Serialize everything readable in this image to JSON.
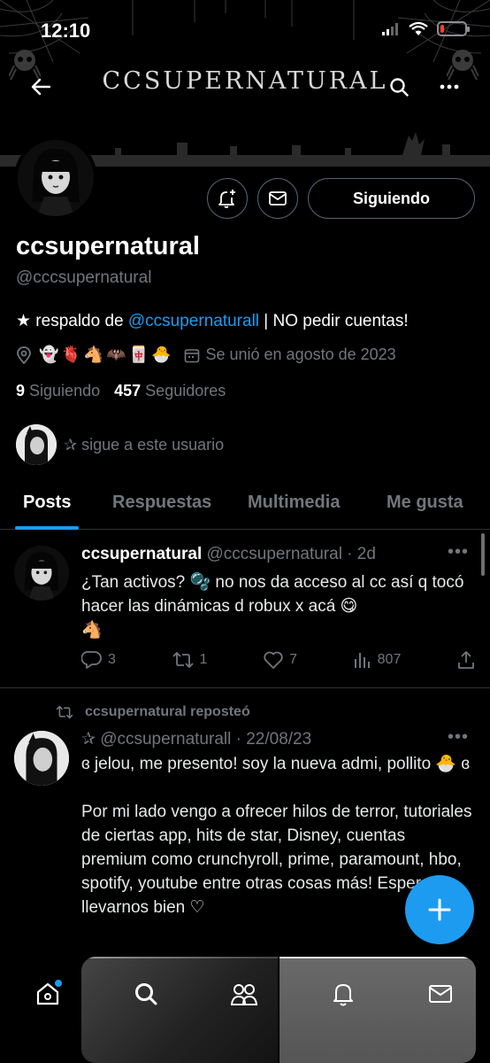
{
  "status_bar": {
    "time": "12:10",
    "battery_level": 0.15
  },
  "header": {
    "banner_title": "CCSUPERNATURAL"
  },
  "profile": {
    "follow_state_label": "Siguiendo",
    "display_name": "ccsupernatural",
    "handle": "@cccsupernatural",
    "bio_prefix": "★ respaldo de ",
    "bio_mention": "@ccsupernaturall",
    "bio_suffix": " | NO pedir cuentas!",
    "location_emojis": "👻🫀🐴🦇🀄🐣",
    "joined": "Se unió en agosto de 2023",
    "following_count": "9",
    "following_label": "Siguiendo",
    "followers_count": "457",
    "followers_label": "Seguidores",
    "followed_by_text": "✰ sigue a este usuario"
  },
  "tabs": [
    "Posts",
    "Respuestas",
    "Multimedia",
    "Me gusta"
  ],
  "posts": [
    {
      "name": "ccsupernatural",
      "meta": "@cccsupernatural · 2d",
      "text": "¿Tan activos? 🫧 no nos da acceso al cc así q tocó hacer las dinámicas d robux x acá 😋\n🐴",
      "replies": "3",
      "reposts": "1",
      "likes": "7",
      "views": "807"
    },
    {
      "repost_label": "ccsupernatural reposteó",
      "name": "✰",
      "meta": "@ccsupernaturall · 22/08/23",
      "text": "ɞ jelou, me presento! soy la nueva admi, pollito 🐣 ɞ\n\nPor mi lado vengo a ofrecer hilos de terror, tutoriales de ciertas app, hits de star, Disney, cuentas premium como crunchyroll, prime, paramount, hbo, spotify, youtube entre otras cosas más! Espero llevarnos bien ♡"
    }
  ],
  "colors": {
    "accent": "#1d9bf0",
    "muted": "#71767b",
    "border": "#2f3336",
    "background": "#000000"
  }
}
